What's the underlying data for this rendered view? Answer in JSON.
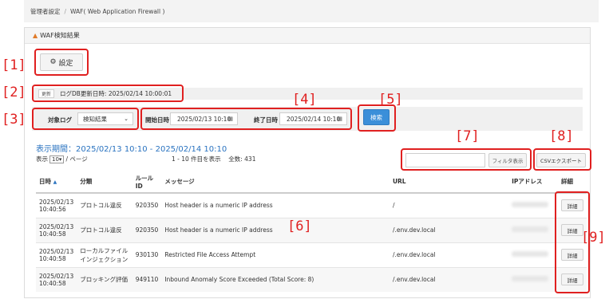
{
  "breadcrumb": {
    "items": [
      "管理者設定",
      "WAF( Web Application Firewall )"
    ],
    "separator": "/"
  },
  "panel": {
    "title": "WAF検知結果"
  },
  "settings": {
    "label": "設定"
  },
  "db": {
    "badge": "更新",
    "text": "ログDB更新日時: 2025/02/14 10:00:01"
  },
  "filter": {
    "target_label": "対象ログ",
    "target_value": "検知結果",
    "start_label": "開始日時",
    "start_value": "2025/02/13 10:10",
    "end_label": "終了日時",
    "end_value": "2025/02/14 10:10",
    "search_label": "検索"
  },
  "period": "表示期間：2025/02/13 10:10 - 2025/02/14 10:10",
  "pager": {
    "prefix": "表示",
    "per_page": "10",
    "suffix": "/ ページ",
    "range": "1 - 10 件目を表示",
    "total": "全数: 431"
  },
  "filter_display_label": "フィルタ表示",
  "csv_label": "CSVエクスポート",
  "table": {
    "headers": {
      "date": "日時",
      "category": "分類",
      "rule": "ルール ID",
      "message": "メッセージ",
      "url": "URL",
      "ip": "IPアドレス",
      "detail": "詳細"
    },
    "rows": [
      {
        "date": "2025/02/13 10:40:56",
        "category": "プロトコル違反",
        "rule": "920350",
        "message": "Host header is a numeric IP address",
        "url": "/",
        "detail": "詳細"
      },
      {
        "date": "2025/02/13 10:40:58",
        "category": "プロトコル違反",
        "rule": "920350",
        "message": "Host header is a numeric IP address",
        "url": "/.env.dev.local",
        "detail": "詳細"
      },
      {
        "date": "2025/02/13 10:40:58",
        "category": "ローカルファイル インジェクション",
        "rule": "930130",
        "message": "Restricted File Access Attempt",
        "url": "/.env.dev.local",
        "detail": "詳細"
      },
      {
        "date": "2025/02/13 10:40:58",
        "category": "ブロッキング評価",
        "rule": "949110",
        "message": "Inbound Anomaly Score Exceeded (Total Score: 8)",
        "url": "/.env.dev.local",
        "detail": "詳細"
      }
    ]
  },
  "callouts": {
    "c1": "[1]",
    "c2": "[2]",
    "c3": "[3]",
    "c4": "[4]",
    "c5": "[5]",
    "c6": "[6]",
    "c7": "[7]",
    "c8": "[8]",
    "c9": "[9]"
  }
}
